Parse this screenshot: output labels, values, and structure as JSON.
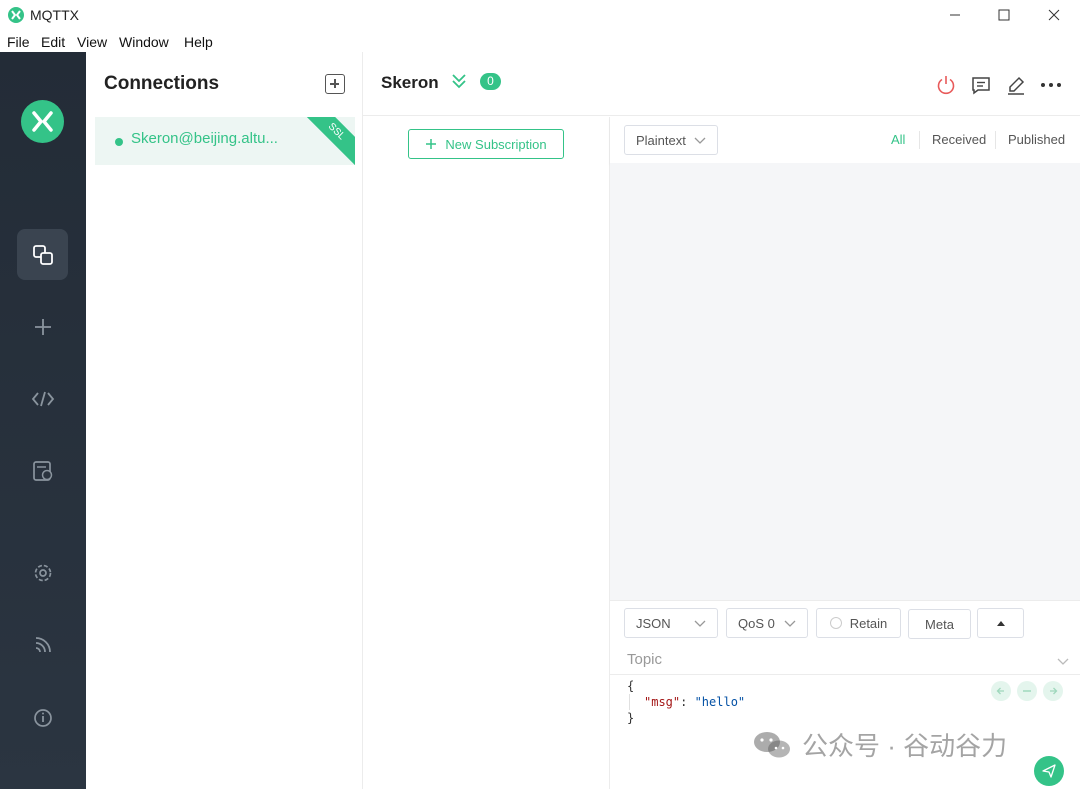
{
  "window": {
    "title": "MQTTX",
    "controls": [
      "minimize-icon",
      "maximize-icon",
      "close-icon"
    ]
  },
  "menu": [
    "File",
    "Edit",
    "View",
    "Window",
    "Help"
  ],
  "sidebar": {
    "logo": "mqttx-logo",
    "items": [
      {
        "icon": "connections-icon",
        "active": true
      },
      {
        "icon": "plus-icon",
        "active": false
      },
      {
        "icon": "script-icon",
        "active": false
      },
      {
        "icon": "log-icon",
        "active": false
      },
      {
        "icon": "gear-icon",
        "active": false
      },
      {
        "icon": "subscribe-icon",
        "active": false
      },
      {
        "icon": "info-icon",
        "active": false
      }
    ]
  },
  "connections": {
    "title": "Connections",
    "items": [
      {
        "name": "Skeron@beijing.altu...",
        "status": "connected",
        "tag": "SSL"
      }
    ]
  },
  "header": {
    "name": "Skeron",
    "badge": "0",
    "icons": [
      "power-icon",
      "comment-icon",
      "edit-icon",
      "more-icon"
    ]
  },
  "subscriptions": {
    "new_label": "New Subscription"
  },
  "messages": {
    "format": "Plaintext",
    "filters": [
      "All",
      "Received",
      "Published"
    ],
    "active_filter": "All"
  },
  "publish": {
    "format": "JSON",
    "qos": "QoS 0",
    "retain_label": "Retain",
    "meta_label": "Meta",
    "topic_placeholder": "Topic",
    "payload_lines": [
      "{",
      "\"msg\": \"hello\"",
      "}"
    ]
  },
  "watermark": "公众号 · 谷动谷力",
  "colors": {
    "accent": "#34c388",
    "sidebar_bg": "#232c37",
    "power": "#e85a5a"
  }
}
